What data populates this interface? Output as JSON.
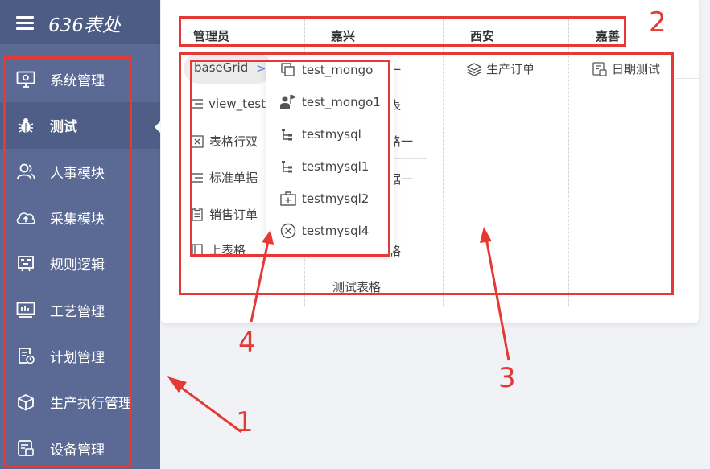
{
  "app": {
    "title": "636表处"
  },
  "sidebar": {
    "items": [
      {
        "label": "系统管理",
        "icon": "monitor-gear-icon"
      },
      {
        "label": "测试",
        "icon": "bug-icon"
      },
      {
        "label": "人事模块",
        "icon": "users-icon"
      },
      {
        "label": "采集模块",
        "icon": "cloud-upload-icon"
      },
      {
        "label": "规则逻辑",
        "icon": "rule-board-icon"
      },
      {
        "label": "工艺管理",
        "icon": "bar-chart-icon"
      },
      {
        "label": "计划管理",
        "icon": "plan-clock-icon"
      },
      {
        "label": "生产执行管理",
        "icon": "cube-icon"
      },
      {
        "label": "设备管理",
        "icon": "device-icon"
      }
    ],
    "active_index": 1
  },
  "columns": {
    "headers": [
      "管理员",
      "嘉兴",
      "西安",
      "嘉善"
    ]
  },
  "col1": {
    "items": [
      {
        "label": "baseGrid",
        "icon": ""
      },
      {
        "label": "view_test",
        "icon": "list-icon"
      },
      {
        "label": "表格行双",
        "icon": "close-box-icon"
      },
      {
        "label": "标准单据",
        "icon": "list-icon"
      },
      {
        "label": "销售订单",
        "icon": "clipboard-icon"
      },
      {
        "label": "上表格",
        "icon": "book-icon"
      }
    ],
    "chevron": ">"
  },
  "col2": {
    "partials": [
      "一",
      "表",
      "格一",
      "据一",
      "格"
    ],
    "bottom_item": "测试表格"
  },
  "col3": {
    "items": [
      {
        "label": "生产订单",
        "icon": "layers-icon"
      }
    ]
  },
  "col4": {
    "items": [
      {
        "label": "日期测试",
        "icon": "date-doc-icon"
      }
    ]
  },
  "popup": {
    "items": [
      {
        "label": "test_mongo",
        "icon": "copy-icon"
      },
      {
        "label": "test_mongo1",
        "icon": "person-flag-icon"
      },
      {
        "label": "testmysql",
        "icon": "tree-icon"
      },
      {
        "label": "testmysql1",
        "icon": "tree-icon"
      },
      {
        "label": "testmysql2",
        "icon": "medkit-icon"
      },
      {
        "label": "testmysql4",
        "icon": "close-circle-icon"
      }
    ]
  },
  "annotations": {
    "color": "#e53935",
    "labels": [
      "1",
      "2",
      "3",
      "4"
    ]
  },
  "colors": {
    "sidebar": "#5a6a94",
    "sidebar_header": "#4d5c85",
    "active_item": "#4f5e87",
    "accent_chevron": "#5a7ad6"
  }
}
